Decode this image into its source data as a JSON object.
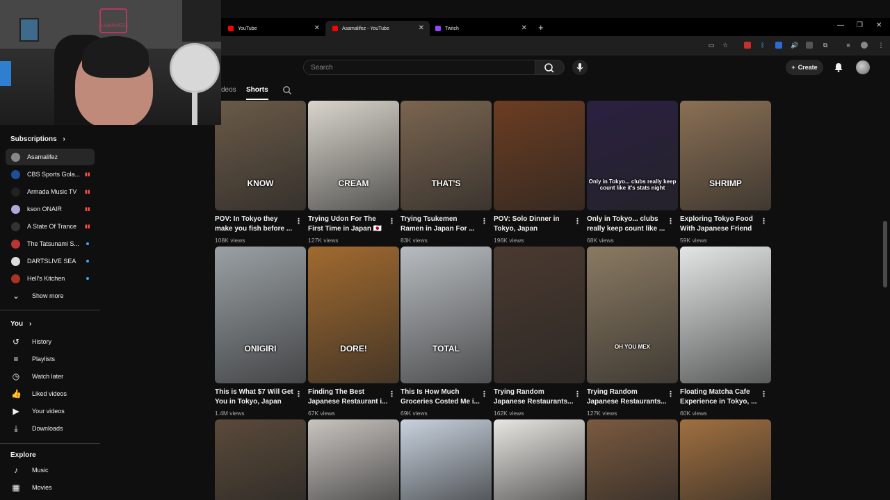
{
  "browser": {
    "tabs": [
      {
        "label": "YouTube",
        "favicon_color": "#ff0000"
      },
      {
        "label": "Asamalifez - YouTube",
        "favicon_color": "#ff0000"
      },
      {
        "label": "Twitch",
        "favicon_color": "#9146ff"
      }
    ],
    "new_tab": "+",
    "close": "✕"
  },
  "webcam": {
    "logo_text": "LoadedGG"
  },
  "youtube": {
    "search_placeholder": "Search",
    "create_label": "Create",
    "channel_tabs": [
      "deos",
      "Shorts"
    ],
    "active_tab": "Shorts"
  },
  "sidebar": {
    "subscriptions_title": "Subscriptions",
    "subscriptions": [
      {
        "name": "Asamalifez",
        "color": "#888",
        "badge": "none"
      },
      {
        "name": "CBS Sports Gola...",
        "color": "#1d4f9a",
        "badge": "live"
      },
      {
        "name": "Armada Music TV",
        "color": "#222",
        "badge": "live"
      },
      {
        "name": "kson ONAIR",
        "color": "#b0a8d8",
        "badge": "live"
      },
      {
        "name": "A State Of Trance",
        "color": "#333",
        "badge": "live"
      },
      {
        "name": "The Tatsunami S...",
        "color": "#b33",
        "badge": "dot"
      },
      {
        "name": "DARTSLIVE SEA",
        "color": "#ddd",
        "badge": "dot"
      },
      {
        "name": "Hell's Kitchen",
        "color": "#a32",
        "badge": "dot"
      }
    ],
    "show_more": "Show more",
    "you_title": "You",
    "you_items": [
      {
        "label": "History",
        "icon": "history-icon"
      },
      {
        "label": "Playlists",
        "icon": "playlists-icon"
      },
      {
        "label": "Watch later",
        "icon": "watch-later-icon"
      },
      {
        "label": "Liked videos",
        "icon": "like-icon"
      },
      {
        "label": "Your videos",
        "icon": "your-videos-icon"
      },
      {
        "label": "Downloads",
        "icon": "download-icon"
      }
    ],
    "explore_title": "Explore",
    "explore_items": [
      {
        "label": "Music",
        "icon": "music-icon"
      },
      {
        "label": "Movies",
        "icon": "movies-icon"
      }
    ]
  },
  "shorts": [
    {
      "line1": "POV: In Tokyo they",
      "line2": "make you fish before ...",
      "views": "108K views",
      "caption": "KNOW",
      "bg": "#6a5a48"
    },
    {
      "line1": "Trying Udon For The",
      "line2": "First Time in Japan 🇯🇵",
      "views": "127K views",
      "caption": "CREAM",
      "bg": "#d9d5cc"
    },
    {
      "line1": "Trying Tsukemen",
      "line2": "Ramen in Japan For ...",
      "views": "83K views",
      "caption": "THAT'S",
      "bg": "#7a6550"
    },
    {
      "line1": "POV: Solo Dinner in",
      "line2": "Tokyo, Japan",
      "views": "196K views",
      "caption": "",
      "bg": "#6b3d22"
    },
    {
      "line1": "Only in Tokyo... clubs",
      "line2": "really keep count like ...",
      "views": "68K views",
      "caption": "Only in Tokyo... clubs really keep count like it's stats night",
      "bg": "#2a2140"
    },
    {
      "line1": "Exploring Tokyo Food",
      "line2": "With Japanese Friend",
      "views": "59K views",
      "caption": "SHRIMP",
      "bg": "#8a7055"
    },
    {
      "line1": "This is What $7 Will Get",
      "line2": "You in Tokyo, Japan",
      "views": "1.4M views",
      "caption": "ONIGIRI",
      "bg": "#9aa0a4"
    },
    {
      "line1": "Finding The Best",
      "line2": "Japanese Restaurant i...",
      "views": "67K views",
      "caption": "DORE!",
      "bg": "#a06a30"
    },
    {
      "line1": "This Is How Much",
      "line2": "Groceries Costed Me i...",
      "views": "69K views",
      "caption": "TOTAL",
      "bg": "#b8bcc0"
    },
    {
      "line1": "Trying Random",
      "line2": "Japanese Restaurants...",
      "views": "162K views",
      "caption": "",
      "bg": "#4a3a30"
    },
    {
      "line1": "Trying Random",
      "line2": "Japanese Restaurants...",
      "views": "127K views",
      "caption": "OH YOU MEX",
      "bg": "#8a7a62"
    },
    {
      "line1": "Floating Matcha Cafe",
      "line2": "Experience in Tokyo, ...",
      "views": "60K views",
      "caption": "",
      "bg": "#e4e6e6"
    },
    {
      "bg": "#5a4a3a"
    },
    {
      "bg": "#c8c4c0"
    },
    {
      "bg": "#c8d2de"
    },
    {
      "bg": "#e8e6e2"
    },
    {
      "bg": "#7a5a40"
    },
    {
      "bg": "#a07040"
    }
  ]
}
